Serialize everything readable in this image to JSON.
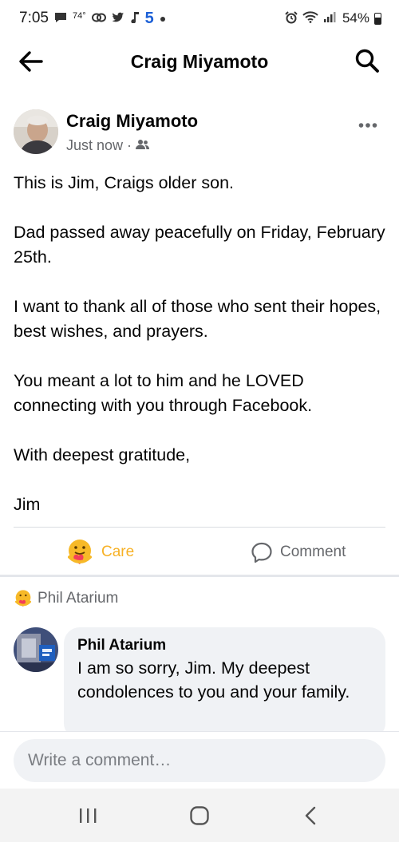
{
  "status_bar": {
    "time": "7:05",
    "temperature": "74°",
    "carrier_badge": "5",
    "battery": "54%"
  },
  "header": {
    "title": "Craig Miyamoto"
  },
  "post": {
    "author": "Craig Miyamoto",
    "timestamp": "Just now · ",
    "audience_icon": "friends-icon",
    "paragraphs": [
      "This is Jim, Craigs older son.",
      "Dad passed away peacefully on Friday, February 25th.",
      "I want to thank all of those who sent their hopes, best wishes, and prayers.",
      "You meant a lot to him and he LOVED connecting with you through Facebook.",
      "With deepest gratitude,",
      "Jim"
    ]
  },
  "actions": {
    "care_label": "Care",
    "comment_label": "Comment"
  },
  "reactions": {
    "reactor": "Phil Atarium"
  },
  "comment": {
    "author": "Phil Atarium",
    "text": "I am so sorry, Jim.   My deepest condolences to you and your family."
  },
  "composer": {
    "placeholder": "Write a comment…"
  },
  "colors": {
    "care": "#f7b125",
    "secondary_text": "#65676b",
    "bubble": "#f0f2f5"
  }
}
